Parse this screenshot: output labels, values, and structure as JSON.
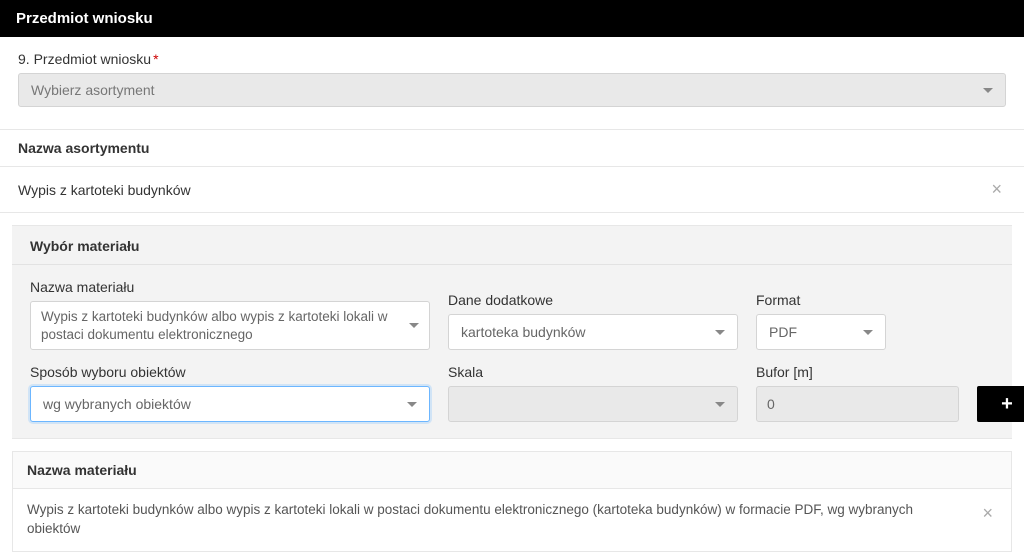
{
  "header": {
    "title": "Przedmiot wniosku"
  },
  "field9": {
    "label": "9. Przedmiot wniosku",
    "placeholder": "Wybierz asortyment"
  },
  "assortment": {
    "section_label": "Nazwa asortymentu",
    "name": "Wypis z kartoteki budynków"
  },
  "material": {
    "panel_title": "Wybór materiału",
    "name_label": "Nazwa materiału",
    "name_value": "Wypis z kartoteki budynków albo wypis z kartoteki lokali w postaci dokumentu elektronicznego",
    "dane_label": "Dane dodatkowe",
    "dane_value": "kartoteka budynków",
    "format_label": "Format",
    "format_value": "PDF",
    "sposob_label": "Sposób wyboru obiektów",
    "sposob_value": "wg wybranych obiektów",
    "skala_label": "Skala",
    "skala_value": "",
    "bufor_label": "Bufor [m]",
    "bufor_value": "0",
    "add": "+"
  },
  "summary": {
    "section_label": "Nazwa materiału",
    "text": "Wypis z kartoteki budynków albo wypis z kartoteki lokali w postaci dokumentu elektronicznego (kartoteka budynków) w formacie PDF, wg wybranych obiektów"
  }
}
